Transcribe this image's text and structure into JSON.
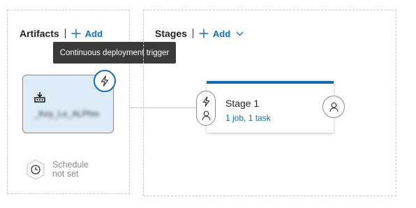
{
  "artifacts": {
    "title": "Artifacts",
    "add_label": "Add",
    "tooltip": "Continuous deployment trigger",
    "card": {
      "name": "_Key_Le_ALPhnms"
    },
    "schedule": {
      "line1": "Schedule",
      "line2": "not set"
    }
  },
  "stages": {
    "title": "Stages",
    "add_label": "Add",
    "items": [
      {
        "name": "Stage 1",
        "detail": "1 job, 1 task"
      }
    ]
  },
  "colors": {
    "accent": "#0f6cbd",
    "artifact_card_bg": "#deecf9",
    "tooltip_bg": "#3b3a39"
  },
  "icons": {
    "trigger": "lightning-icon",
    "artifact": "build-icon",
    "schedule": "clock-icon",
    "approval": "person-icon",
    "add": "plus-icon",
    "dropdown": "chevron-down-icon"
  }
}
